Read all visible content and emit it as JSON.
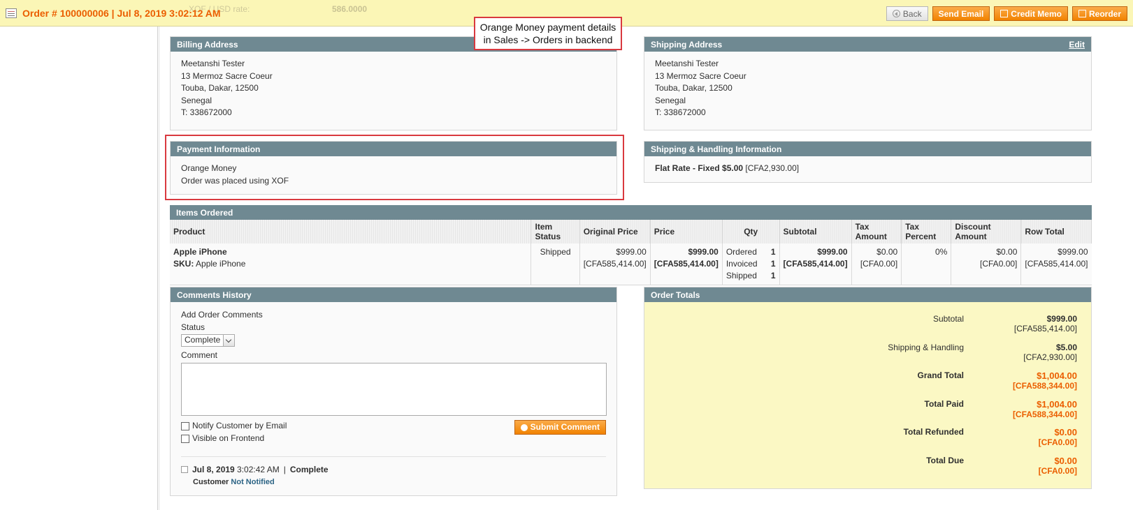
{
  "header": {
    "order_title": "Order # 100000006 | Jul 8, 2019 3:02:12 AM",
    "rate_label": "XOF / USD rate:",
    "rate_value": "586.0000",
    "buttons": {
      "back": "Back",
      "send_email": "Send Email",
      "credit_memo": "Credit Memo",
      "reorder": "Reorder"
    }
  },
  "callout": {
    "line1": "Orange Money payment details",
    "line2": "in Sales -> Orders in backend"
  },
  "billing": {
    "title": "Billing Address",
    "lines": [
      "Meetanshi Tester",
      "13 Mermoz Sacre Coeur",
      "Touba, Dakar, 12500",
      "Senegal",
      "T: 338672000"
    ]
  },
  "shipping": {
    "title": "Shipping Address",
    "edit": "Edit",
    "lines": [
      "Meetanshi Tester",
      "13 Mermoz Sacre Coeur",
      "Touba, Dakar, 12500",
      "Senegal",
      "T: 338672000"
    ]
  },
  "payment": {
    "title": "Payment Information",
    "method": "Orange Money",
    "note": "Order was placed using XOF"
  },
  "shipping_handling": {
    "title": "Shipping & Handling Information",
    "method": "Flat Rate - Fixed $5.00",
    "converted": " [CFA2,930.00]"
  },
  "items": {
    "title": "Items Ordered",
    "headers": [
      "Product",
      "Item Status",
      "Original Price",
      "Price",
      "Qty",
      "Subtotal",
      "Tax Amount",
      "Tax Percent",
      "Discount Amount",
      "Row Total"
    ],
    "row": {
      "name": "Apple iPhone",
      "sku_label": "SKU:",
      "sku": " Apple iPhone",
      "status": "Shipped",
      "original_price": "$999.00",
      "original_price_cfa": "[CFA585,414.00]",
      "price": "$999.00",
      "price_cfa": "[CFA585,414.00]",
      "qty": [
        {
          "label": "Ordered",
          "value": "1"
        },
        {
          "label": "Invoiced",
          "value": "1"
        },
        {
          "label": "Shipped",
          "value": "1"
        }
      ],
      "subtotal": "$999.00",
      "subtotal_cfa": "[CFA585,414.00]",
      "tax_amount": "$0.00",
      "tax_amount_cfa": "[CFA0.00]",
      "tax_percent": "0%",
      "discount": "$0.00",
      "discount_cfa": "[CFA0.00]",
      "row_total": "$999.00",
      "row_total_cfa": "[CFA585,414.00]"
    }
  },
  "comments": {
    "title": "Comments History",
    "add_label": "Add Order Comments",
    "status_label": "Status",
    "status_value": "Complete",
    "comment_label": "Comment",
    "comment_value": "",
    "notify_label": "Notify Customer by Email",
    "visible_label": "Visible on Frontend",
    "submit": "Submit Comment",
    "history": {
      "date": "Jul 8, 2019",
      "time": " 3:02:42 AM",
      "sep": "|",
      "status": "Complete",
      "customer_label": "Customer",
      "notified": "Not Notified"
    }
  },
  "totals": {
    "title": "Order Totals",
    "rows": [
      {
        "label": "Subtotal",
        "amount": "$999.00",
        "cfa": "[CFA585,414.00]"
      },
      {
        "label": "Shipping & Handling",
        "amount": "$5.00",
        "cfa": "[CFA2,930.00]"
      },
      {
        "label": "Grand Total",
        "amount": "$1,004.00",
        "cfa": "[CFA588,344.00]"
      },
      {
        "label": "Total Paid",
        "amount": "$1,004.00",
        "cfa": "[CFA588,344.00]"
      },
      {
        "label": "Total Refunded",
        "amount": "$0.00",
        "cfa": "[CFA0.00]"
      },
      {
        "label": "Total Due",
        "amount": "$0.00",
        "cfa": "[CFA0.00]"
      }
    ]
  }
}
